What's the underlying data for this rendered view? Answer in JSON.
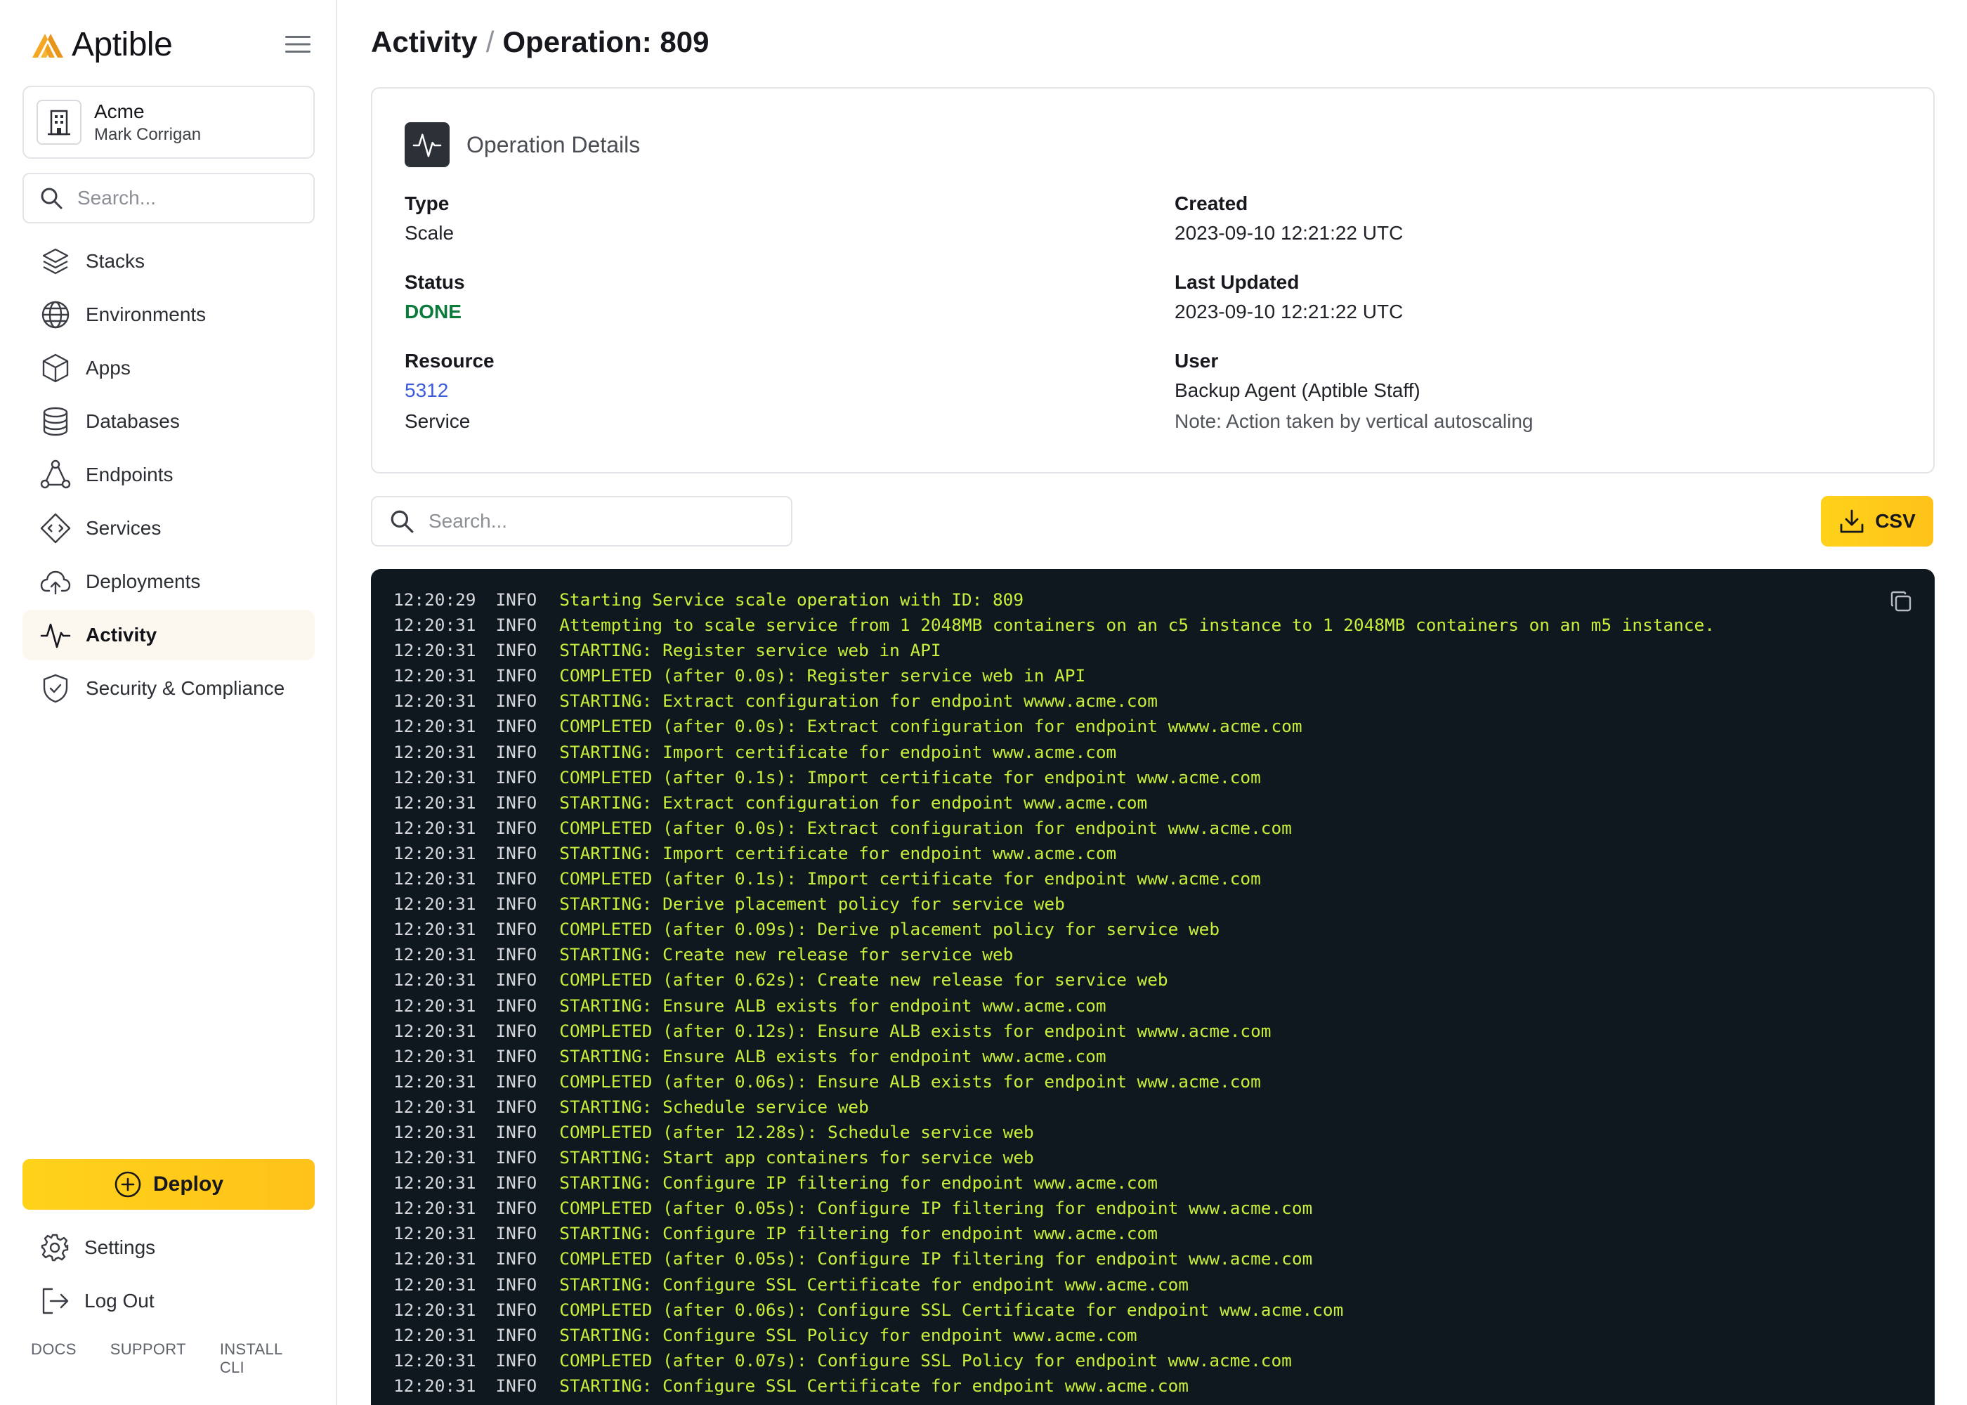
{
  "brand": {
    "name": "Aptible"
  },
  "org": {
    "name": "Acme",
    "user": "Mark Corrigan"
  },
  "sidebar_search": {
    "placeholder": "Search..."
  },
  "nav": [
    {
      "label": "Stacks",
      "icon": "stacks-icon"
    },
    {
      "label": "Environments",
      "icon": "globe-icon"
    },
    {
      "label": "Apps",
      "icon": "cube-icon"
    },
    {
      "label": "Databases",
      "icon": "database-icon"
    },
    {
      "label": "Endpoints",
      "icon": "endpoints-icon"
    },
    {
      "label": "Services",
      "icon": "code-diamond-icon"
    },
    {
      "label": "Deployments",
      "icon": "cloud-upload-icon"
    },
    {
      "label": "Activity",
      "icon": "activity-pulse-icon",
      "active": true
    },
    {
      "label": "Security & Compliance",
      "icon": "shield-check-icon"
    }
  ],
  "deploy": {
    "label": "Deploy"
  },
  "settings": {
    "label": "Settings"
  },
  "logout": {
    "label": "Log Out"
  },
  "footer": {
    "docs": "DOCS",
    "support": "SUPPORT",
    "install_cli": "INSTALL CLI"
  },
  "breadcrumb": {
    "parent": "Activity",
    "separator": "/",
    "current": "Operation: 809"
  },
  "details": {
    "title": "Operation Details",
    "type_label": "Type",
    "type_value": "Scale",
    "status_label": "Status",
    "status_value": "DONE",
    "resource_label": "Resource",
    "resource_id": "5312",
    "resource_type": "Service",
    "created_label": "Created",
    "created_value": "2023-09-10 12:21:22 UTC",
    "updated_label": "Last Updated",
    "updated_value": "2023-09-10 12:21:22 UTC",
    "user_label": "User",
    "user_value": "Backup Agent (Aptible Staff)",
    "user_note": "Note: Action taken by vertical autoscaling"
  },
  "log_search": {
    "placeholder": "Search..."
  },
  "csv": {
    "label": "CSV"
  },
  "colors": {
    "accent": "#FFC61A",
    "done": "#0B7A3B",
    "log_bg": "#0F181F",
    "log_msg": "#C6EF3C",
    "link": "#3B5BDB"
  },
  "logs": [
    {
      "time": "12:20:29",
      "level": "INFO",
      "msg": "Starting Service scale operation with ID: 809"
    },
    {
      "time": "12:20:31",
      "level": "INFO",
      "msg": "Attempting to scale service from 1 2048MB containers on an c5 instance to 1 2048MB containers on an m5 instance."
    },
    {
      "time": "12:20:31",
      "level": "INFO",
      "msg": "STARTING: Register service web in API"
    },
    {
      "time": "12:20:31",
      "level": "INFO",
      "msg": "COMPLETED (after 0.0s): Register service web in API"
    },
    {
      "time": "12:20:31",
      "level": "INFO",
      "msg": "STARTING: Extract configuration for endpoint wwww.acme.com"
    },
    {
      "time": "12:20:31",
      "level": "INFO",
      "msg": "COMPLETED (after 0.0s): Extract configuration for endpoint wwww.acme.com"
    },
    {
      "time": "12:20:31",
      "level": "INFO",
      "msg": "STARTING: Import certificate for endpoint www.acme.com"
    },
    {
      "time": "12:20:31",
      "level": "INFO",
      "msg": "COMPLETED (after 0.1s): Import certificate for endpoint www.acme.com"
    },
    {
      "time": "12:20:31",
      "level": "INFO",
      "msg": "STARTING: Extract configuration for endpoint www.acme.com"
    },
    {
      "time": "12:20:31",
      "level": "INFO",
      "msg": "COMPLETED (after 0.0s): Extract configuration for endpoint www.acme.com"
    },
    {
      "time": "12:20:31",
      "level": "INFO",
      "msg": "STARTING: Import certificate for endpoint www.acme.com"
    },
    {
      "time": "12:20:31",
      "level": "INFO",
      "msg": "COMPLETED (after 0.1s): Import certificate for endpoint www.acme.com"
    },
    {
      "time": "12:20:31",
      "level": "INFO",
      "msg": "STARTING: Derive placement policy for service web"
    },
    {
      "time": "12:20:31",
      "level": "INFO",
      "msg": "COMPLETED (after 0.09s): Derive placement policy for service web"
    },
    {
      "time": "12:20:31",
      "level": "INFO",
      "msg": "STARTING: Create new release for service web"
    },
    {
      "time": "12:20:31",
      "level": "INFO",
      "msg": "COMPLETED (after 0.62s): Create new release for service web"
    },
    {
      "time": "12:20:31",
      "level": "INFO",
      "msg": "STARTING: Ensure ALB exists for endpoint www.acme.com"
    },
    {
      "time": "12:20:31",
      "level": "INFO",
      "msg": "COMPLETED (after 0.12s): Ensure ALB exists for endpoint wwww.acme.com"
    },
    {
      "time": "12:20:31",
      "level": "INFO",
      "msg": "STARTING: Ensure ALB exists for endpoint www.acme.com"
    },
    {
      "time": "12:20:31",
      "level": "INFO",
      "msg": "COMPLETED (after 0.06s): Ensure ALB exists for endpoint www.acme.com"
    },
    {
      "time": "12:20:31",
      "level": "INFO",
      "msg": "STARTING: Schedule service web"
    },
    {
      "time": "12:20:31",
      "level": "INFO",
      "msg": "COMPLETED (after 12.28s): Schedule service web"
    },
    {
      "time": "12:20:31",
      "level": "INFO",
      "msg": "STARTING: Start app containers for service web"
    },
    {
      "time": "12:20:31",
      "level": "INFO",
      "msg": "STARTING: Configure IP filtering for endpoint www.acme.com"
    },
    {
      "time": "12:20:31",
      "level": "INFO",
      "msg": "COMPLETED (after 0.05s): Configure IP filtering for endpoint www.acme.com"
    },
    {
      "time": "12:20:31",
      "level": "INFO",
      "msg": "STARTING: Configure IP filtering for endpoint www.acme.com"
    },
    {
      "time": "12:20:31",
      "level": "INFO",
      "msg": "COMPLETED (after 0.05s): Configure IP filtering for endpoint www.acme.com"
    },
    {
      "time": "12:20:31",
      "level": "INFO",
      "msg": "STARTING: Configure SSL Certificate for endpoint www.acme.com"
    },
    {
      "time": "12:20:31",
      "level": "INFO",
      "msg": "COMPLETED (after 0.06s): Configure SSL Certificate for endpoint www.acme.com"
    },
    {
      "time": "12:20:31",
      "level": "INFO",
      "msg": "STARTING: Configure SSL Policy for endpoint www.acme.com"
    },
    {
      "time": "12:20:31",
      "level": "INFO",
      "msg": "COMPLETED (after 0.07s): Configure SSL Policy for endpoint www.acme.com"
    },
    {
      "time": "12:20:31",
      "level": "INFO",
      "msg": "STARTING: Configure SSL Certificate for endpoint www.acme.com"
    }
  ]
}
